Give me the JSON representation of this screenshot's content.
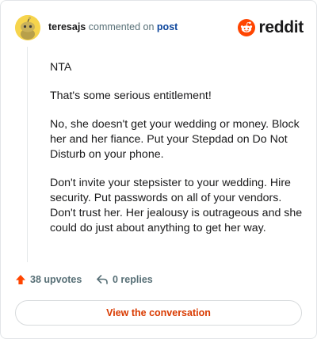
{
  "header": {
    "username": "teresajs",
    "action_text": "commented on",
    "post_link": "post",
    "logo_text": "reddit"
  },
  "comment": {
    "paragraphs": [
      "NTA",
      "That's some serious entitlement!",
      "No, she doesn't get your wedding or money. Block her and her fiance. Put your Stepdad on Do Not Disturb on your phone.",
      "Don't invite your stepsister to your wedding. Hire security. Put passwords on all of your vendors. Don't trust her. Her jealousy is outrageous and she could do just about anything to get her way."
    ]
  },
  "footer": {
    "upvotes": "38 upvotes",
    "replies": "0 replies"
  },
  "cta": {
    "label": "View the conversation"
  },
  "colors": {
    "brand": "#ff4500",
    "link": "#0a449b",
    "cta_text": "#d93a00"
  },
  "icons": {
    "avatar": "snoo-avatar",
    "logo": "reddit-logo-icon",
    "upvote": "upvote-arrow-icon",
    "reply": "reply-arrow-icon"
  }
}
